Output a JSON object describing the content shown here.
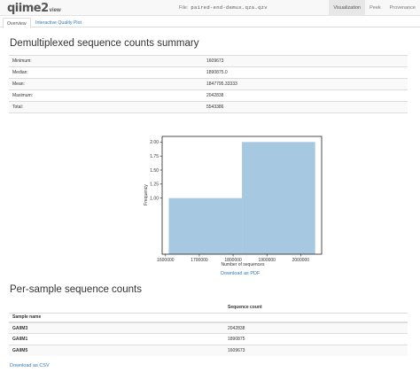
{
  "header": {
    "logo_main": "qiime2",
    "logo_sub": "view",
    "file_label": "File:",
    "file_name": "paired-end-demux.qza.qzv",
    "tabs": [
      "Visualization",
      "Peek",
      "Provenance"
    ]
  },
  "subtabs": [
    "Overview",
    "Interactive Quality Plot"
  ],
  "summary": {
    "title": "Demultiplexed sequence counts summary",
    "rows": [
      {
        "label": "Minimum:",
        "value": "1609673"
      },
      {
        "label": "Median:",
        "value": "1890875.0"
      },
      {
        "label": "Mean:",
        "value": "1847795.33333"
      },
      {
        "label": "Maximum:",
        "value": "2042838"
      },
      {
        "label": "Total:",
        "value": "5543386"
      }
    ]
  },
  "chart_data": {
    "type": "bar",
    "title": "",
    "xlabel": "Number of sequences",
    "ylabel": "Frequency",
    "bins": [
      {
        "start": 1609673,
        "end": 1826255.5,
        "count": 1
      },
      {
        "start": 1826255.5,
        "end": 2042838,
        "count": 2
      }
    ],
    "xlim": [
      1590000,
      2062000
    ],
    "ylim": [
      0,
      2.1
    ],
    "xticks": [
      1600000,
      1700000,
      1800000,
      1900000,
      2000000
    ],
    "xtick_labels": [
      "1600000",
      "1700000",
      "1800000",
      "1900000",
      "2000000"
    ],
    "yticks": [
      1.0,
      1.25,
      1.5,
      1.75,
      2.0
    ],
    "ytick_labels": [
      "1.00",
      "1.25",
      "1.50",
      "1.75",
      "2.00"
    ],
    "bar_color": "#a6c8e0",
    "grid": false
  },
  "download_pdf": "Download as PDF",
  "per_sample": {
    "title": "Per-sample sequence counts",
    "column_header": "Sequence count",
    "index_header": "Sample name",
    "rows": [
      {
        "name": "GAIIM3",
        "count": "2042838"
      },
      {
        "name": "GAIIM1",
        "count": "1890875"
      },
      {
        "name": "GAIIM5",
        "count": "1609673"
      }
    ]
  },
  "download_csv": "Download as CSV"
}
